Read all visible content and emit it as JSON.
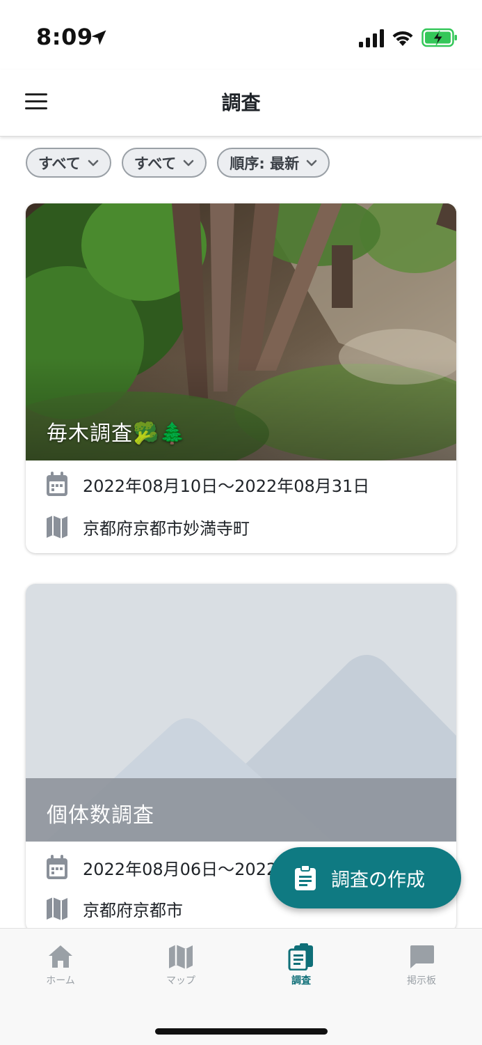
{
  "status_bar": {
    "time": "8:09"
  },
  "header": {
    "title": "調査"
  },
  "filters": [
    {
      "label": "すべて"
    },
    {
      "label": "すべて"
    },
    {
      "label": "順序: 最新"
    }
  ],
  "cards": [
    {
      "title": "毎木調査🥦🌲",
      "date_range": "2022年08月10日〜2022年08月31日",
      "location": "京都府京都市妙満寺町"
    },
    {
      "title": "個体数調査",
      "date_range": "2022年08月06日〜2022",
      "location": "京都府京都市"
    }
  ],
  "fab": {
    "label": "調査の作成"
  },
  "bottom_nav": {
    "items": [
      {
        "label": "ホーム",
        "icon": "home-icon"
      },
      {
        "label": "マップ",
        "icon": "map-icon"
      },
      {
        "label": "調査",
        "icon": "clipboard-icon",
        "active": true
      },
      {
        "label": "掲示板",
        "icon": "chat-icon"
      }
    ]
  },
  "colors": {
    "accent": "#0f7a82",
    "chip_bg": "#eceef1",
    "nav_inactive": "#9aa0a6",
    "battery": "#34c759"
  }
}
